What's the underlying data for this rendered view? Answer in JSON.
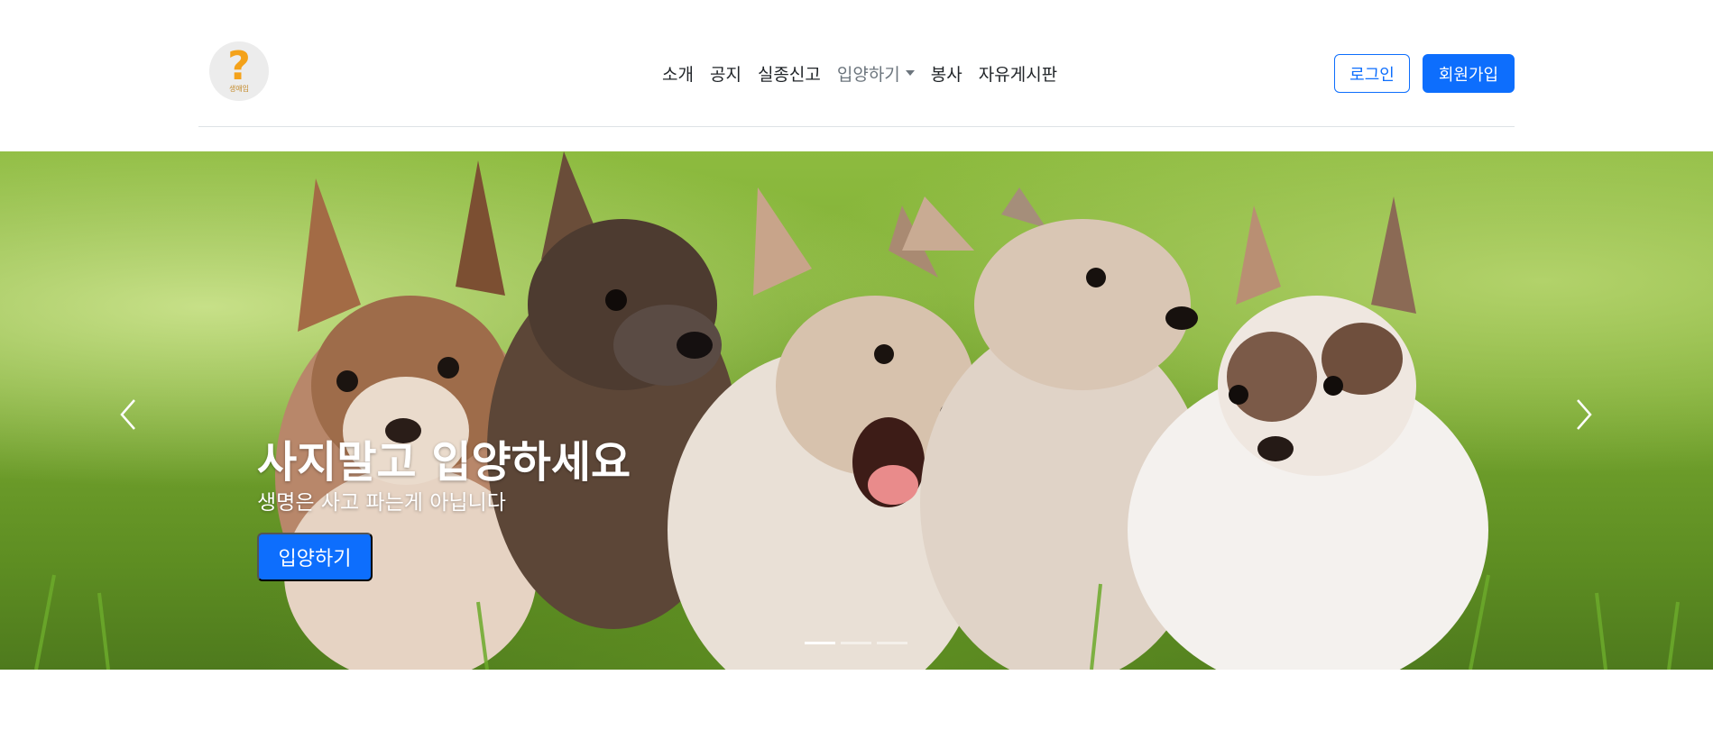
{
  "logo": {
    "mark": "?",
    "caption": "생애입"
  },
  "nav": {
    "items": [
      {
        "label": "소개"
      },
      {
        "label": "공지"
      },
      {
        "label": "실종신고"
      },
      {
        "label": "입양하기"
      },
      {
        "label": "봉사"
      },
      {
        "label": "자유게시판"
      }
    ]
  },
  "auth": {
    "login_label": "로그인",
    "signup_label": "회원가입"
  },
  "hero": {
    "title": "사지말고 입양하세요",
    "subtitle": "생명은 사고 파는게 아닙니다",
    "cta_label": "입양하기",
    "active_slide": 1,
    "slide_count": 3
  },
  "colors": {
    "primary": "#0d6efd",
    "text": "#212529",
    "muted": "#6c757d"
  },
  "icons": {
    "prev": "chevron-left-icon",
    "next": "chevron-right-icon",
    "dropdown": "caret-down-icon"
  }
}
